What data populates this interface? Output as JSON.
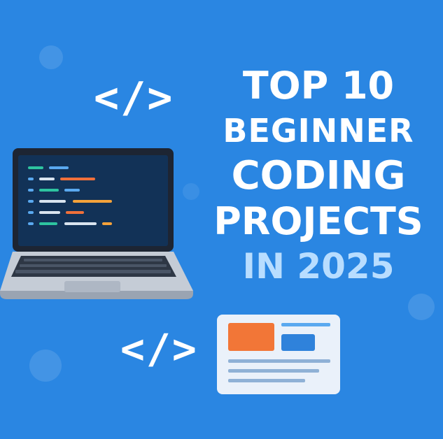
{
  "headline": {
    "line1": "TOP 10",
    "line2": "BEGINNER",
    "line3": "CODING",
    "line4": "PROJECTS",
    "line5": "IN 2025"
  },
  "decor": {
    "code_tag_top": "</>",
    "code_tag_bottom": "</>",
    "icons": [
      "laptop-icon",
      "code-editor-icon",
      "webpage-card-icon",
      "code-tag-icon"
    ]
  },
  "colors": {
    "background": "#2a86e2",
    "headline_text": "#ffffff",
    "accent_text": "#b8ddff",
    "laptop_body": "#c5ccd6",
    "laptop_screen": "#123257",
    "code_teal": "#2ec4a0",
    "code_blue": "#5aa9f0",
    "code_orange": "#f0703a",
    "code_gold": "#f4a23a",
    "card_orange": "#f27637",
    "card_blue": "#2f82db"
  }
}
